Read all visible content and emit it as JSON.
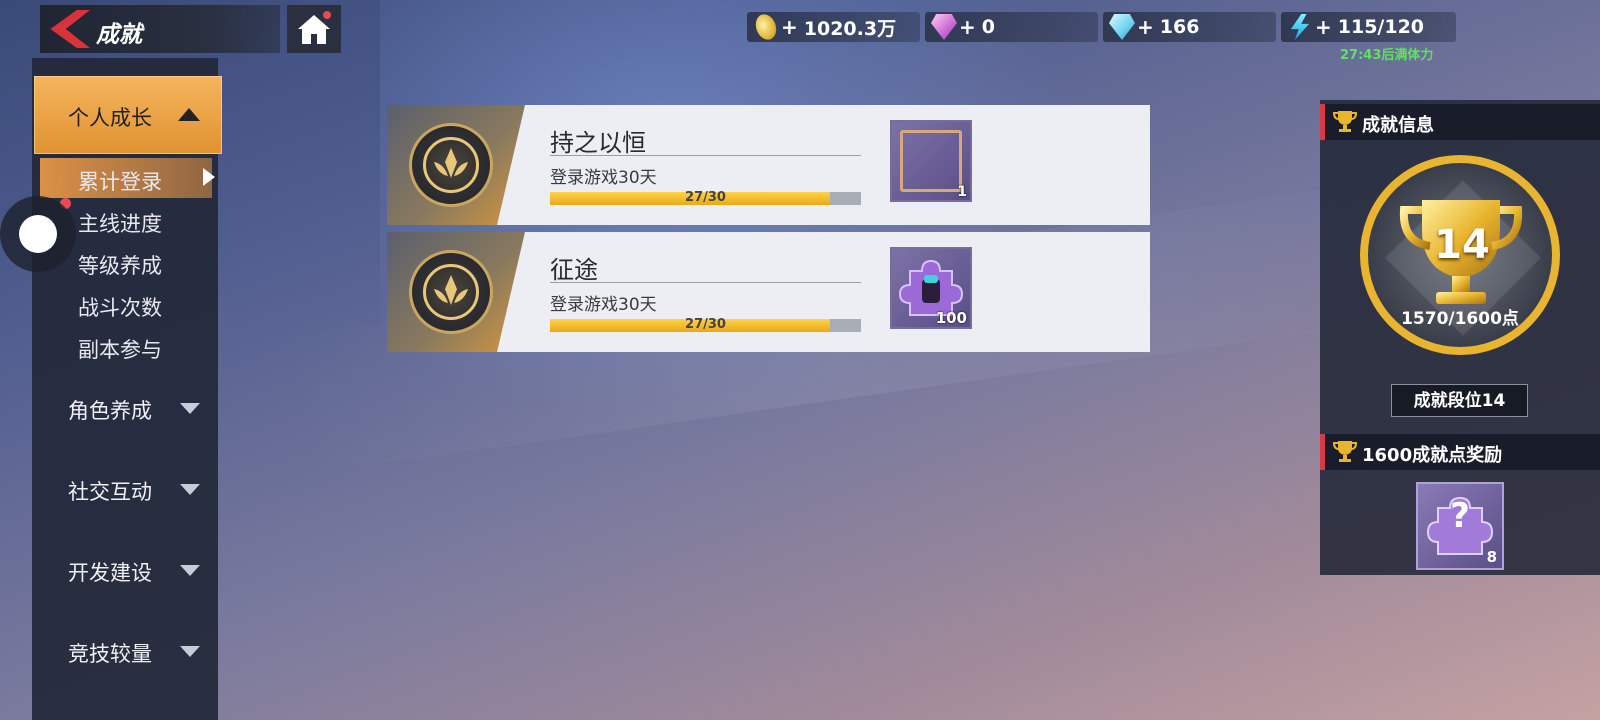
{
  "header": {
    "back_title": "成就"
  },
  "resources": [
    {
      "icon": "gold-coin-icon",
      "value": "1020.3万"
    },
    {
      "icon": "pink-gem-icon",
      "value": "0"
    },
    {
      "icon": "blue-diamond-icon",
      "value": "166"
    },
    {
      "icon": "stamina-bolt-icon",
      "value": "115/120"
    }
  ],
  "stamina_note": "27:43后满体力",
  "sidebar": {
    "active_category": "个人成长",
    "sub_items": [
      "累计登录",
      "主线进度",
      "等级养成",
      "战斗次数",
      "副本参与"
    ],
    "categories": [
      "角色养成",
      "社交互动",
      "开发建设",
      "竞技较量"
    ]
  },
  "achievements": [
    {
      "title": "持之以恒",
      "desc": "登录游戏30天",
      "progress_text": "27/30",
      "progress": 0.9,
      "reward_count": "1",
      "reward_icon": "avatar-frame-icon"
    },
    {
      "title": "征途",
      "desc": "登录游戏30天",
      "progress_text": "27/30",
      "progress": 0.9,
      "reward_count": "100",
      "reward_icon": "puzzle-piece-icon"
    }
  ],
  "info": {
    "header": "成就信息",
    "level": "14",
    "points": "1570/1600点",
    "rank": "成就段位14",
    "reward_header": "1600成就点奖励",
    "reward_symbol": "?",
    "reward_count": "8"
  },
  "colors": {
    "accent_orange": "#e09332",
    "gold": "#e9b530",
    "progress_fill": "#e8a918",
    "notice_red": "#e84a5a"
  }
}
